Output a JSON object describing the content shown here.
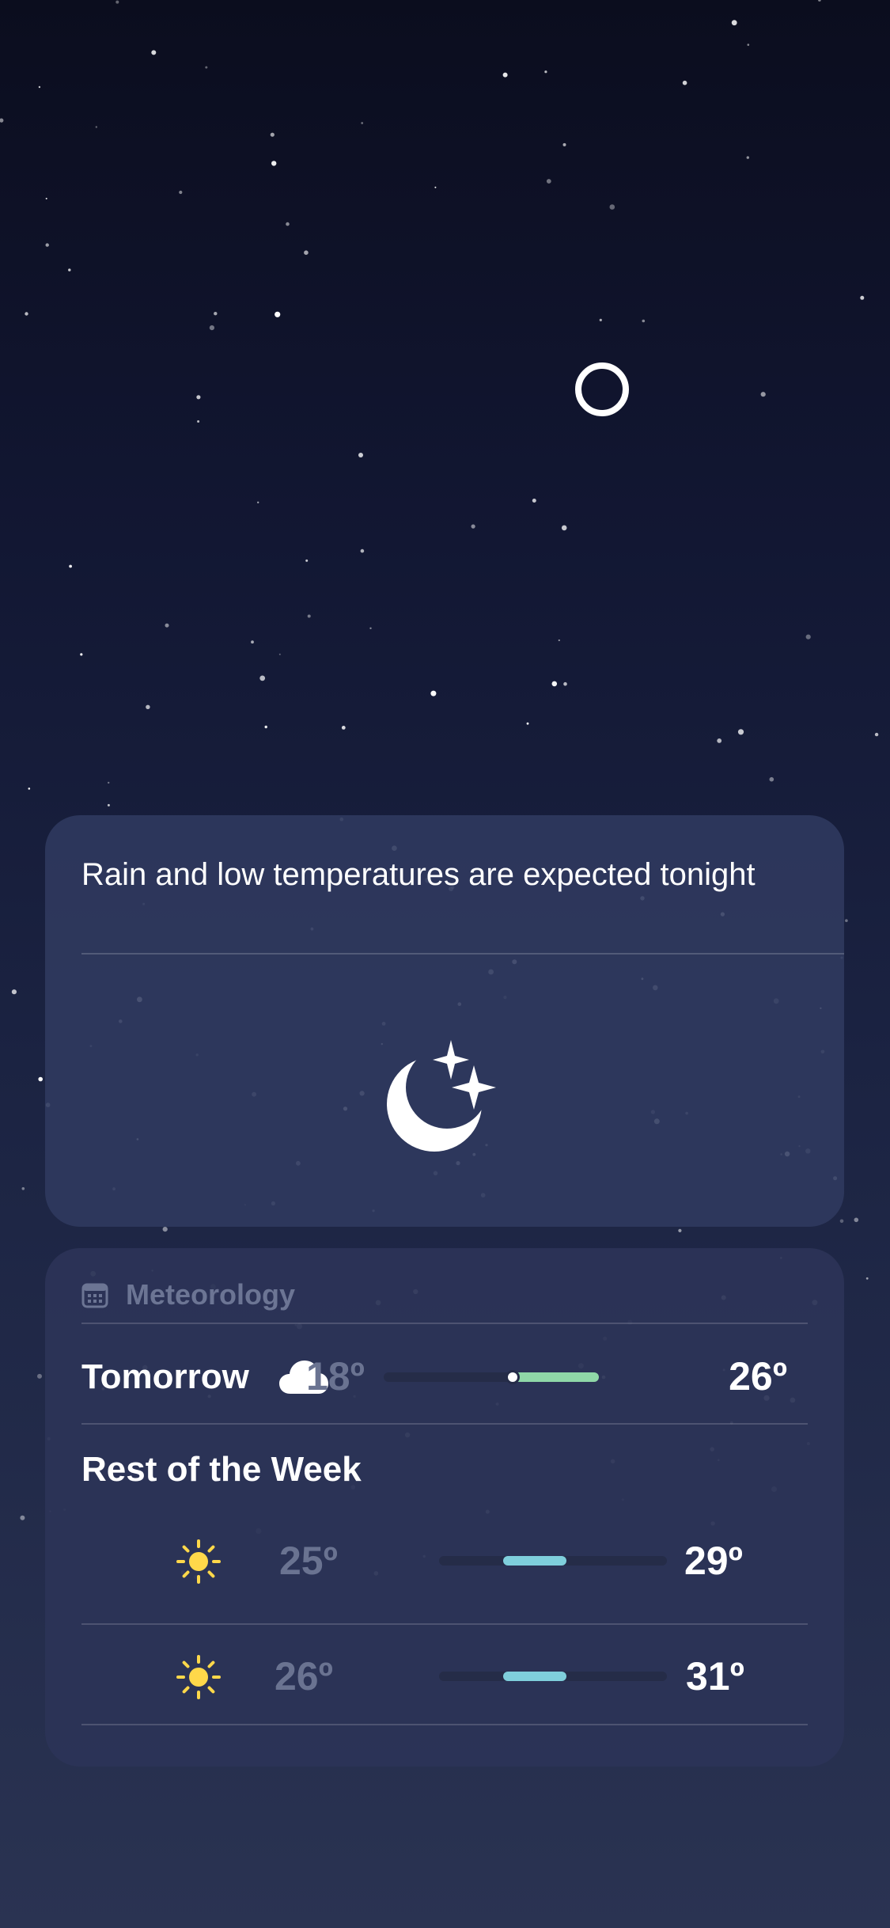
{
  "colors": {
    "background_top": "#0b0d1e",
    "background_bottom": "#2a3352",
    "card": "#303a60",
    "muted_text": "#6a7391",
    "tomorrow_bar": "#8fd8a8",
    "week_bar": "#7fcfdc",
    "sun": "#ffd84a"
  },
  "alert": {
    "message": "Rain and low temperatures are expected tonight",
    "icon": "moon-stars-icon"
  },
  "forecast": {
    "source_icon": "calendar-icon",
    "source_label": "Meteorology",
    "tomorrow": {
      "label": "Tomorrow",
      "icon": "cloud-icon",
      "low": "18º",
      "high": "26º",
      "range_fill": [
        0.6,
        1.0
      ],
      "current_marker": 0.6
    },
    "rest_of_week_title": "Rest of the Week",
    "rest_of_week": [
      {
        "icon": "sun-icon",
        "low": "25º",
        "high": "29º",
        "range_fill": [
          0.28,
          0.56
        ]
      },
      {
        "icon": "sun-icon",
        "low": "26º",
        "high": "31º",
        "range_fill": [
          0.28,
          0.56
        ]
      }
    ]
  }
}
